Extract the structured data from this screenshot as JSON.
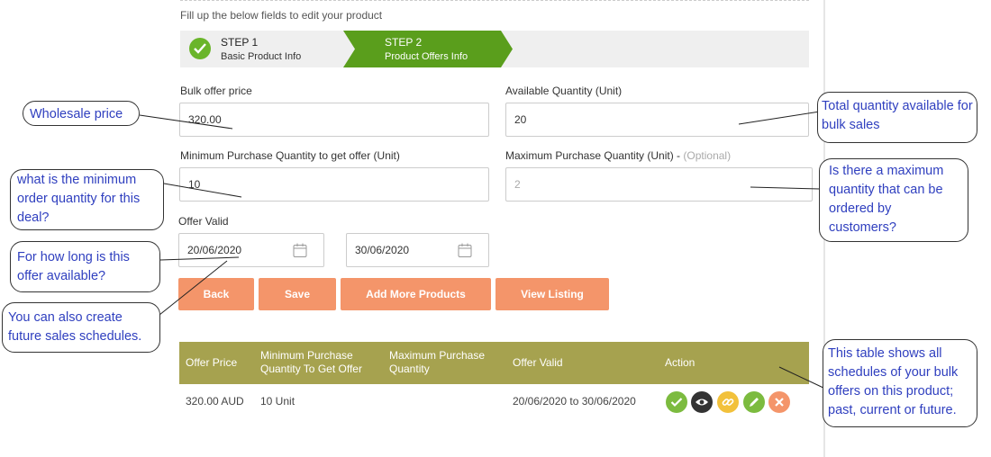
{
  "intro": "Fill up the below fields to edit your product",
  "steps": [
    {
      "title": "STEP 1",
      "subtitle": "Basic Product Info",
      "status": "complete"
    },
    {
      "title": "STEP 2",
      "subtitle": "Product Offers Info",
      "status": "active"
    }
  ],
  "form": {
    "bulk_price": {
      "label": "Bulk offer price",
      "value": "320.00"
    },
    "available_qty": {
      "label": "Available Quantity (Unit)",
      "value": "20"
    },
    "min_qty": {
      "label": "Minimum Purchase Quantity to get offer (Unit)",
      "value": "10"
    },
    "max_qty": {
      "label": "Maximum Purchase Quantity (Unit) -",
      "optional": "(Optional)",
      "value": "2"
    },
    "offer_valid": {
      "label": "Offer Valid",
      "from": "20/06/2020",
      "to": "30/06/2020"
    }
  },
  "buttons": {
    "back": "Back",
    "save": "Save",
    "add_more": "Add More Products",
    "view_listing": "View Listing"
  },
  "table": {
    "headers": [
      "Offer Price",
      "Minimum Purchase Quantity To Get Offer",
      "Maximum Purchase Quantity",
      "Offer Valid",
      "Action"
    ],
    "rows": [
      {
        "price": "320.00 AUD",
        "min": "10 Unit",
        "max": "",
        "valid": "20/06/2020 to 30/06/2020"
      }
    ]
  },
  "annotations": {
    "wholesale": "Wholesale price",
    "total_qty": "Total quantity available for bulk sales",
    "min_order": "what is the minimum order quantity for this deal?",
    "max_qty": "Is there a maximum quantity that can be ordered by customers?",
    "how_long": "For how long is this offer available?",
    "future": "You can also create future sales schedules.",
    "table": "This table shows all schedules of your bulk offers on this product; past, current or future."
  },
  "colors": {
    "accent_button": "#f4956a",
    "step_active": "#5a9e1c",
    "step_complete": "#6ab52a",
    "table_header": "#a6a24f",
    "annotation_text": "#2f3fbf"
  },
  "icons": {
    "step_complete": "check-icon",
    "date": "calendar-icon",
    "actions": [
      "check-icon",
      "eye-icon",
      "link-icon",
      "pencil-icon",
      "close-icon"
    ]
  }
}
